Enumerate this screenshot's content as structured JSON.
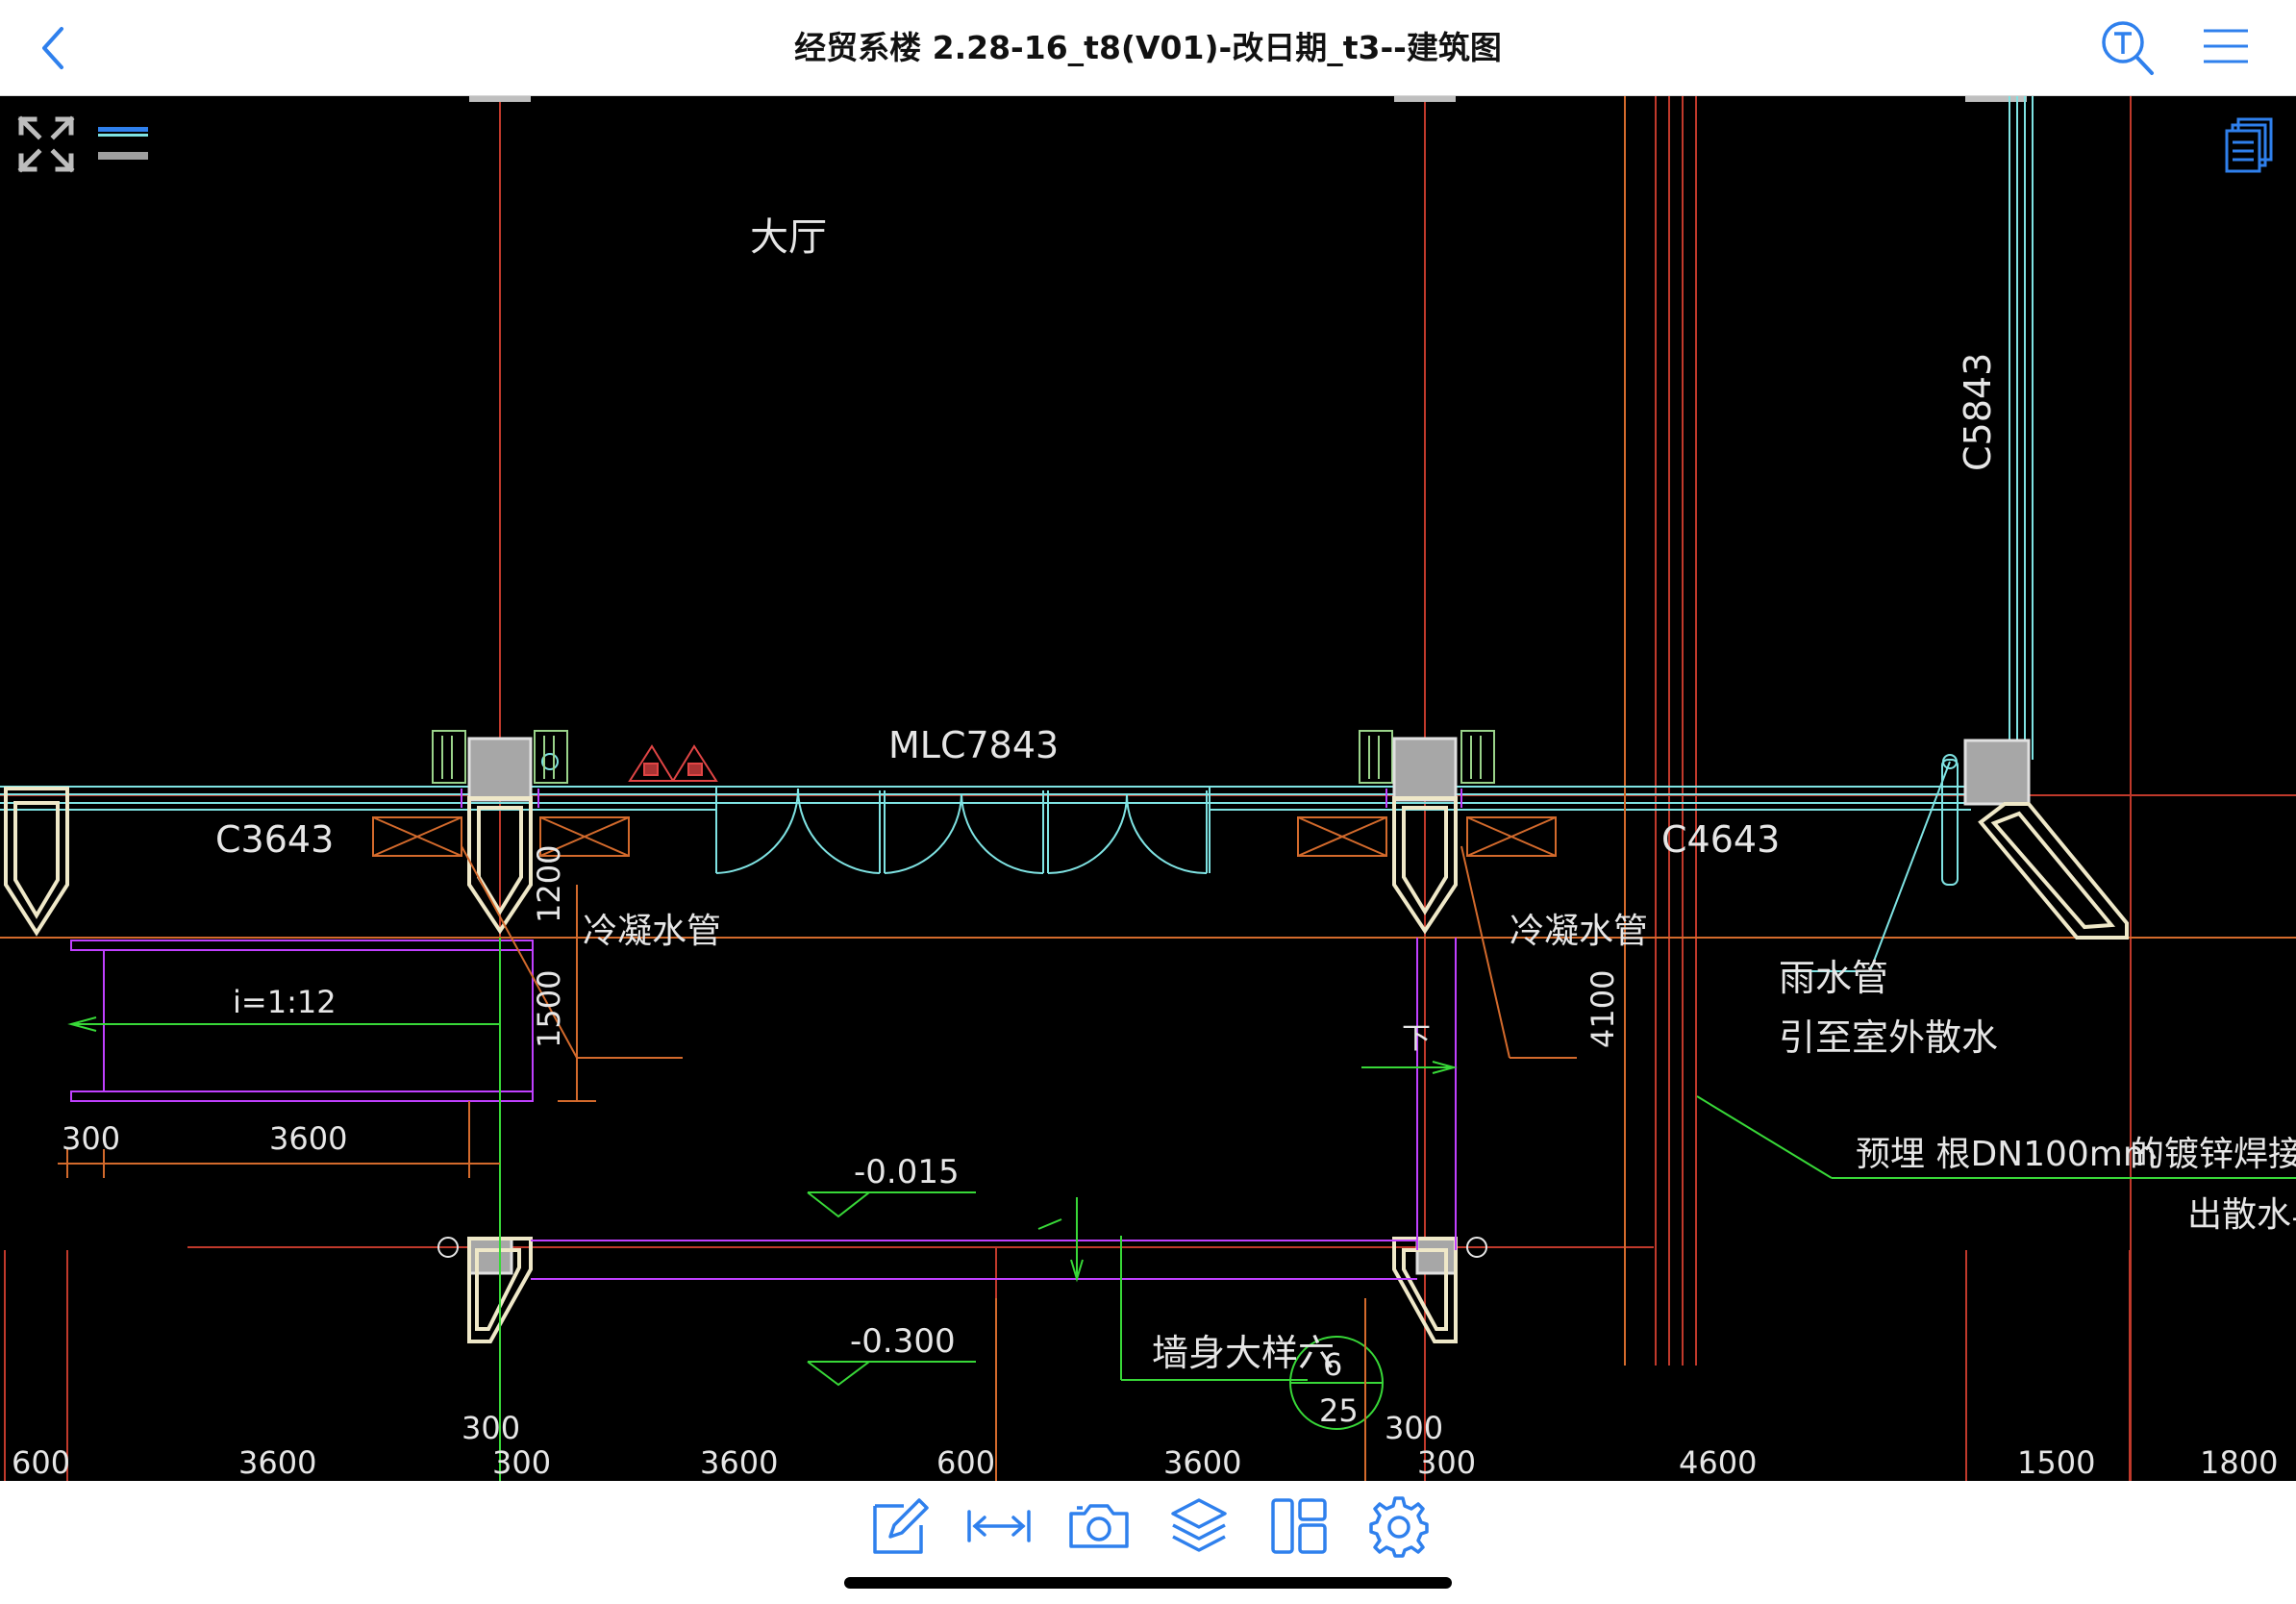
{
  "header": {
    "title": "经贸系楼 2.28-16_t8(V01)-改日期_t3--建筑图"
  },
  "icons": {
    "back": "chevron-left-icon",
    "text_search": "text-search-icon",
    "menu": "menu-icon",
    "fullscreen": "expand-icon",
    "layer_toggle": "layer-lines-icon",
    "sheets": "sheets-stack-icon",
    "edit": "edit-note-icon",
    "measure": "measure-icon",
    "camera": "camera-icon",
    "layers": "layers-icon",
    "layout": "layout-icon",
    "settings": "settings-icon"
  },
  "colors": {
    "accent": "#2f80ed",
    "canvas": "#000000",
    "axis_red": "#c0392b",
    "wall_cyan": "#7fe3e3",
    "text_gray": "#e6e6e6",
    "annot_green": "#38d838",
    "magenta": "#c040ff"
  },
  "drawing": {
    "room_label": "大厅",
    "door_label": "MLC7843",
    "window_left": "C3643",
    "window_right": "C4643",
    "window_vertical": "C5843",
    "condensate_left": "冷凝水管",
    "condensate_right": "冷凝水管",
    "rain_pipe": "雨水管",
    "rain_pipe_note": "引至室外散水",
    "embed_note": "预埋  根DN100mm",
    "galvanized_note": "的镀锌焊接钢",
    "outlet_note": "出散水与",
    "slope": "i=1:12",
    "elev_1": "-0.015",
    "elev_2": "-0.300",
    "wall_detail": "墙身大样六",
    "detail_num": "6",
    "detail_sheet": "25",
    "down_arrow_label": "下",
    "dim_1200": "1200",
    "dim_1500": "1500",
    "dim_4100": "4100",
    "dim_300_a": "300",
    "dim_3600_a": "3600",
    "dim_300_b": "300",
    "dim_300_c": "300",
    "bottom_dims": [
      "600",
      "3600",
      "300",
      "3600",
      "600",
      "3600",
      "300",
      "4600",
      "1500",
      "1800"
    ]
  }
}
